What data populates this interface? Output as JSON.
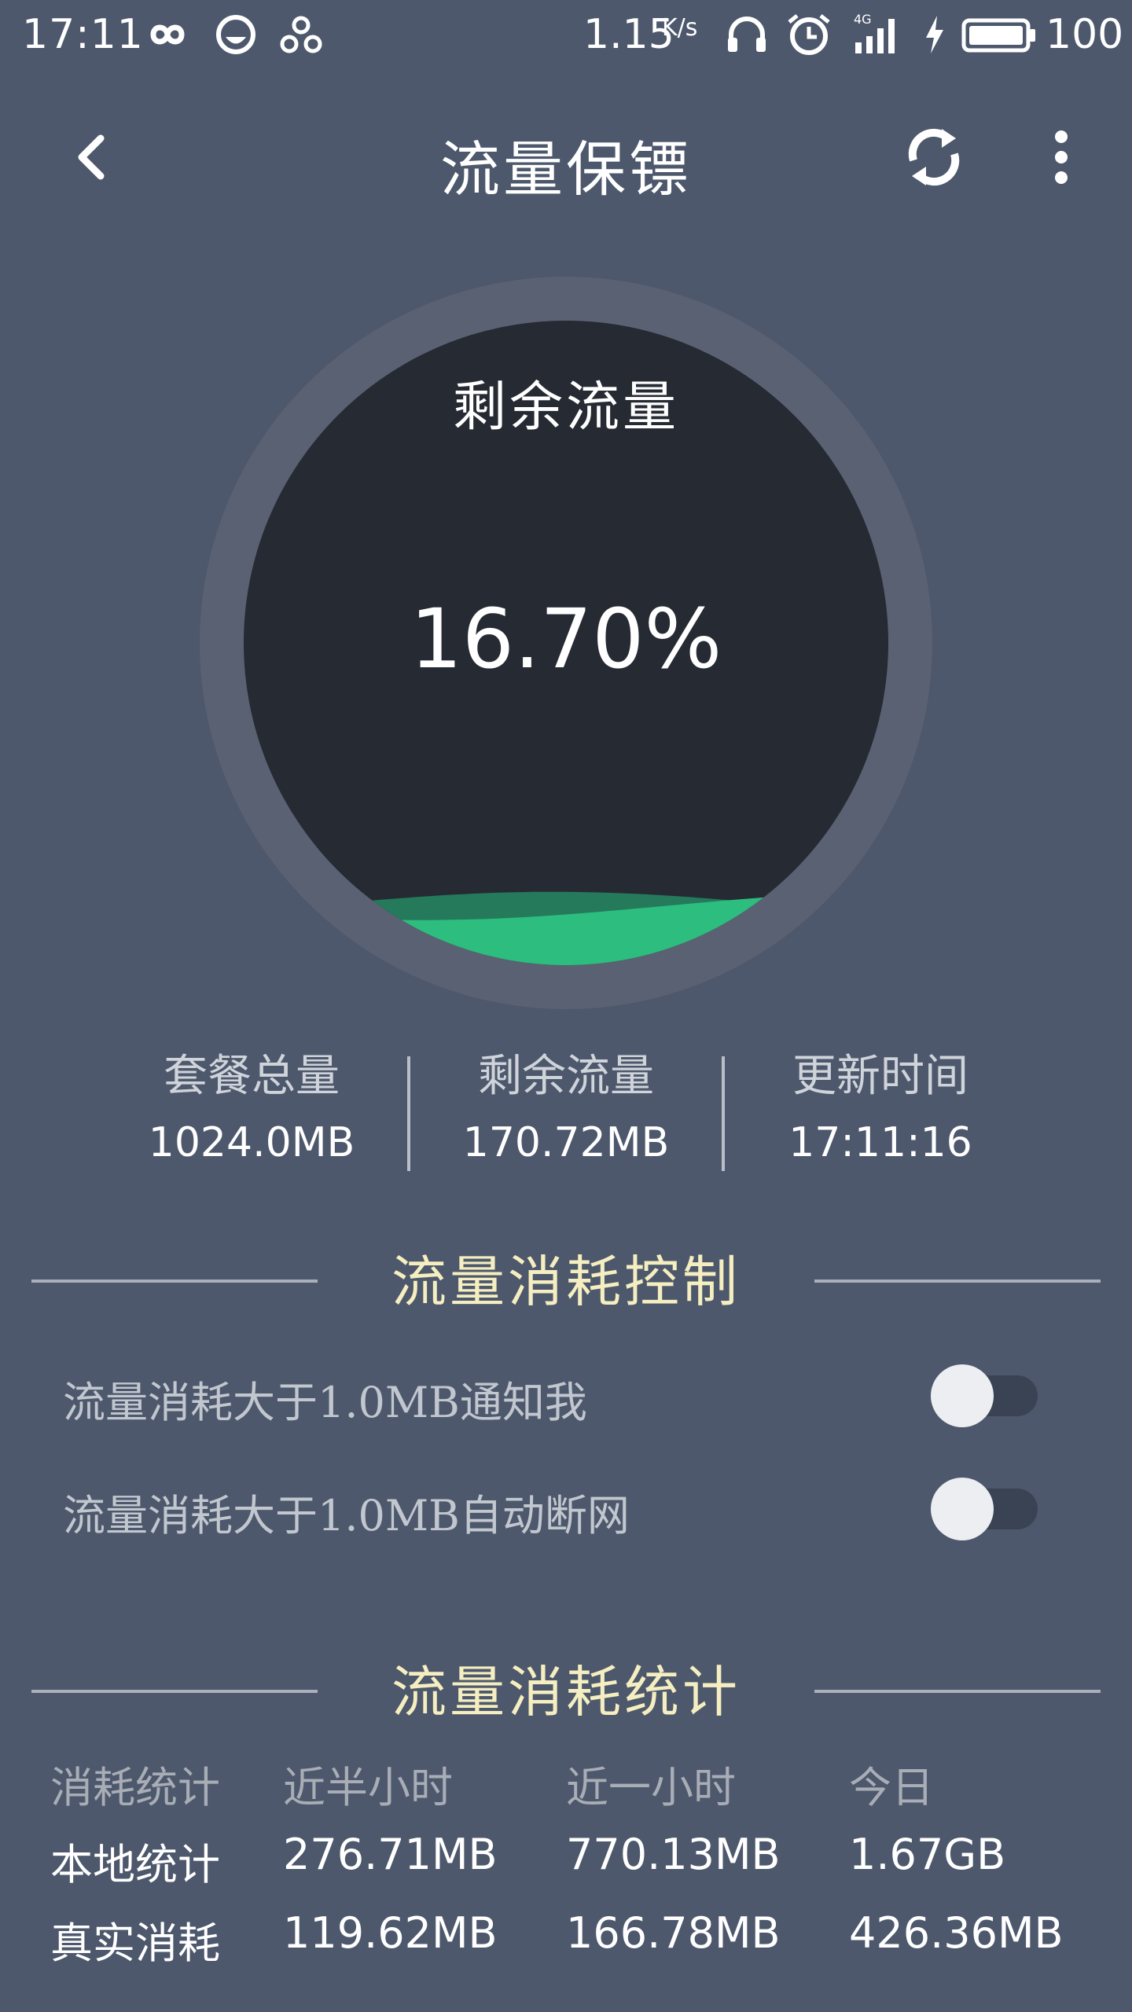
{
  "status_bar": {
    "time": "17:11",
    "network_speed": "1.15",
    "speed_unit": "K/s",
    "network_type": "4G",
    "battery_level": "100"
  },
  "app_bar": {
    "title": "流量保镖",
    "back_icon": "back-arrow-icon",
    "refresh_icon": "refresh-icon",
    "more_icon": "more-vertical-icon"
  },
  "gauge": {
    "title": "剩余流量",
    "percent_text": "16.70%",
    "remaining_fraction": 0.167,
    "wave_color": "#2dbd7f",
    "back_wave_color": "#247a5a",
    "ring_color": "#5a6172",
    "inner_color": "#252a33"
  },
  "summary": {
    "total": {
      "label": "套餐总量",
      "value": "1024.0MB"
    },
    "remaining": {
      "label": "剩余流量",
      "value": "170.72MB"
    },
    "updated": {
      "label": "更新时间",
      "value": "17:11:16"
    }
  },
  "control": {
    "heading": "流量消耗控制",
    "notify": {
      "label": "流量消耗大于1.0MB通知我",
      "enabled": false
    },
    "disconnect": {
      "label": "流量消耗大于1.0MB自动断网",
      "enabled": false
    }
  },
  "stats": {
    "heading": "流量消耗统计",
    "columns": [
      "消耗统计",
      "近半小时",
      "近一小时",
      "今日"
    ],
    "rows": [
      {
        "label": "本地统计",
        "half_hour": "276.71MB",
        "one_hour": "770.13MB",
        "today": "1.67GB"
      },
      {
        "label": "真实消耗",
        "half_hour": "119.62MB",
        "one_hour": "166.78MB",
        "today": "426.36MB"
      }
    ]
  },
  "colors": {
    "background": "#4d586c",
    "heading_accent": "#f5eec0",
    "wave_green": "#2dbd7f"
  }
}
